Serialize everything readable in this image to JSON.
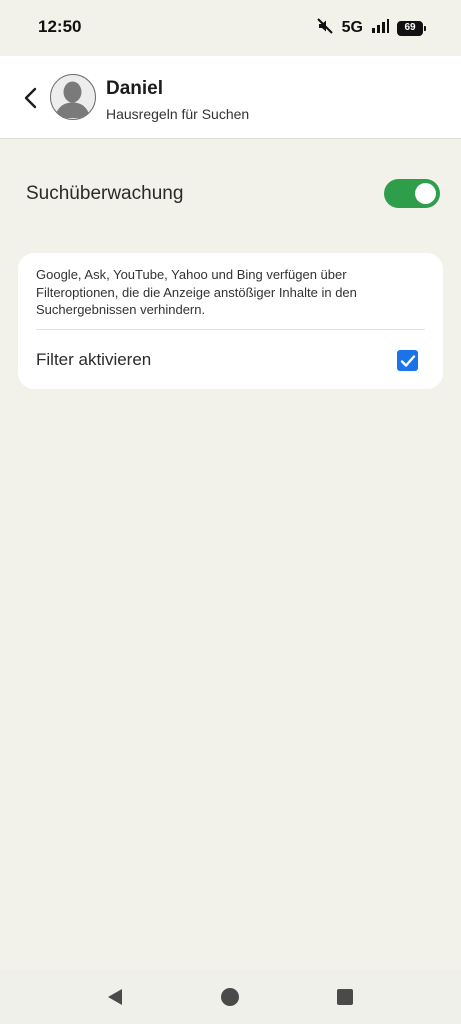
{
  "status_bar": {
    "time": "12:50",
    "network": "5G",
    "battery": "69",
    "icons": [
      "mute-icon",
      "signal-icon",
      "battery-icon"
    ]
  },
  "header": {
    "title": "Daniel",
    "subtitle": "Hausregeln für Suchen",
    "back_icon": "chevron-left-icon",
    "avatar_icon": "person-icon"
  },
  "search_monitoring": {
    "label": "Suchüberwachung",
    "enabled": true
  },
  "filter_card": {
    "description": "Google, Ask, YouTube, Yahoo und Bing verfügen über Filteroptionen, die die Anzeige anstößiger Inhalte in den Suchergebnissen verhindern.",
    "filter_label": "Filter aktivieren",
    "filter_checked": true
  },
  "nav_bar": {
    "icons": [
      "back-triangle-icon",
      "home-circle-icon",
      "recents-square-icon"
    ]
  },
  "colors": {
    "background": "#f2f2ea",
    "toggle_on": "#2e9e4b",
    "checkbox": "#1a73e8"
  }
}
